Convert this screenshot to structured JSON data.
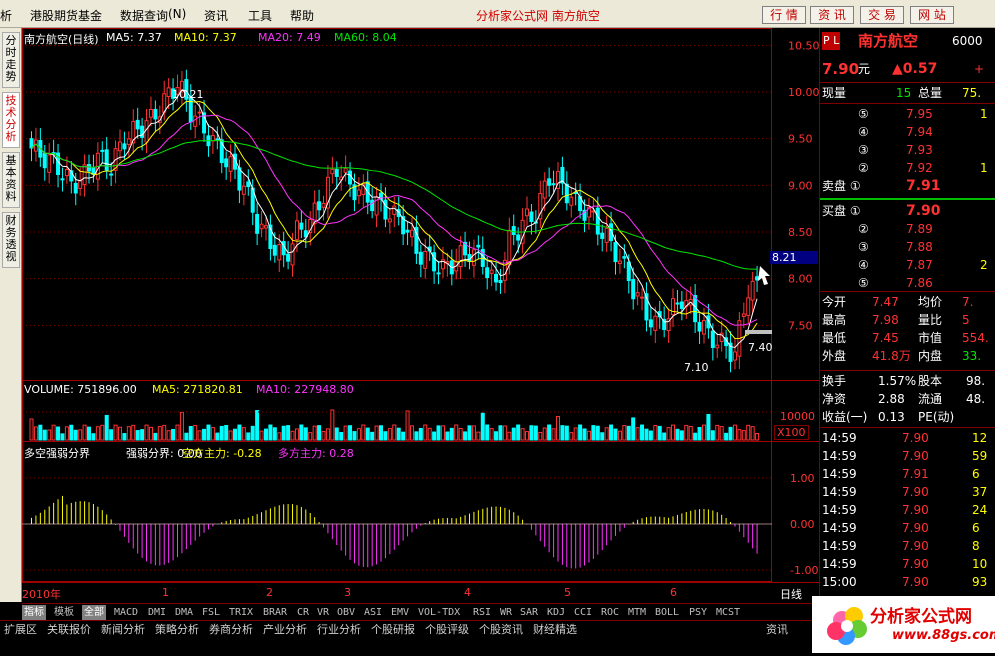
{
  "menu": {
    "items": [
      "析",
      "港股期货基金",
      "数据查询",
      "资讯",
      "工具",
      "帮助"
    ],
    "query_key": "(N)",
    "center": "分析家公式网  南方航空",
    "buttons": [
      "行 情",
      "资 讯",
      "交 易",
      "网 站"
    ]
  },
  "sidetabs": [
    "分时走势",
    "技术分析",
    "基本资料",
    "财务透视"
  ],
  "chart": {
    "main_title": "南方航空(日线)",
    "ma5": "MA5: 7.37",
    "ma10": "MA10: 7.37",
    "ma20": "MA20: 7.49",
    "ma60": "MA60: 8.04",
    "price_ticks": [
      "10.50",
      "10.00",
      "9.50",
      "9.00",
      "8.50",
      "8.00",
      "7.50"
    ],
    "current_price_tag": "8.21",
    "high_label": "10.21",
    "low_label": "7.10",
    "last_label": "7.40",
    "vol_title": "VOLUME: 751896.00",
    "vol_ma5": "MA5: 271820.81",
    "vol_ma10": "MA10: 227948.80",
    "vol_tick": "10000",
    "vol_unit": "X100",
    "ind_title": "多空强弱分界",
    "ind_a": "强弱分界: 0.00",
    "ind_b": "空方主力: -0.28",
    "ind_c": "多方主力: 0.28",
    "ind_ticks": [
      "1.00",
      "0.00",
      "-1.00"
    ],
    "x_labels": [
      "2010年",
      "1",
      "2",
      "3",
      "4",
      "5",
      "6"
    ],
    "period": "日线"
  },
  "chart_data": {
    "type": "candlestick",
    "title": "南方航空(日线)",
    "ylim": [
      7.0,
      10.6
    ],
    "high": 10.21,
    "low": 7.1,
    "last": 7.9,
    "close_approx": [
      9.4,
      9.3,
      9.2,
      9.0,
      9.1,
      9.3,
      9.2,
      9.5,
      9.6,
      9.7,
      9.9,
      10.1,
      9.8,
      9.6,
      9.4,
      9.2,
      9.0,
      8.6,
      8.4,
      8.2,
      8.5,
      8.6,
      8.9,
      9.2,
      9.0,
      8.9,
      8.8,
      8.7,
      8.6,
      8.3,
      8.2,
      8.1,
      8.2,
      8.3,
      8.2,
      7.9,
      8.4,
      8.6,
      8.7,
      9.1,
      9.0,
      8.8,
      8.7,
      8.5,
      8.3,
      8.0,
      7.7,
      7.5,
      7.6,
      7.8,
      7.6,
      7.4,
      7.3,
      7.2,
      7.9
    ]
  },
  "quote": {
    "flag": "P L",
    "name": "南方航空",
    "code": "6000",
    "price": "7.90",
    "unit": "元",
    "change": "▲0.57",
    "plus": "+",
    "xianliang_lbl": "现量",
    "xianliang": "15",
    "zongliang_lbl": "总量",
    "zongliang": "75.",
    "asks": [
      {
        "n": "⑤",
        "p": "7.95",
        "v": "1"
      },
      {
        "n": "④",
        "p": "7.94",
        "v": ""
      },
      {
        "n": "③",
        "p": "7.93",
        "v": ""
      },
      {
        "n": "②",
        "p": "7.92",
        "v": "1"
      }
    ],
    "ask1_lbl": "卖盘 ①",
    "ask1": "7.91",
    "bid1_lbl": "买盘 ①",
    "bid1": "7.90",
    "bids": [
      {
        "n": "②",
        "p": "7.89",
        "v": ""
      },
      {
        "n": "③",
        "p": "7.88",
        "v": ""
      },
      {
        "n": "④",
        "p": "7.87",
        "v": "2"
      },
      {
        "n": "⑤",
        "p": "7.86",
        "v": ""
      }
    ],
    "stats": [
      [
        "今开",
        "7.47",
        "均价",
        "7."
      ],
      [
        "最高",
        "7.98",
        "量比",
        "5"
      ],
      [
        "最低",
        "7.45",
        "市值",
        "554."
      ],
      [
        "外盘",
        "41.8万",
        "内盘",
        "33."
      ]
    ],
    "stats2": [
      [
        "换手",
        "1.57%",
        "股本",
        "98."
      ],
      [
        "净资",
        "2.88",
        "流通",
        "48."
      ],
      [
        "收益(一)",
        "0.13",
        "PE(动)",
        ""
      ]
    ],
    "ticks": [
      [
        "14:59",
        "7.90",
        "12"
      ],
      [
        "14:59",
        "7.90",
        "59"
      ],
      [
        "14:59",
        "7.91",
        "6"
      ],
      [
        "14:59",
        "7.90",
        "37"
      ],
      [
        "14:59",
        "7.90",
        "24"
      ],
      [
        "14:59",
        "7.90",
        "6"
      ],
      [
        "14:59",
        "7.90",
        "8"
      ],
      [
        "14:59",
        "7.90",
        "10"
      ],
      [
        "15:00",
        "7.90",
        "93"
      ],
      [
        "15:00",
        "7.90",
        "6"
      ]
    ]
  },
  "tabs1": [
    "指标",
    "模板",
    "全部",
    "MACD",
    "DMI",
    "DMA",
    "FSL",
    "TRIX",
    "BRAR",
    "CR",
    "VR",
    "OBV",
    "ASI",
    "EMV",
    "VOL-TDX",
    "RSI",
    "WR",
    "SAR",
    "KDJ",
    "CCI",
    "ROC",
    "MTM",
    "BOLL",
    "PSY",
    "MCST"
  ],
  "tabs2": [
    "扩展区",
    "关联报价",
    "新闻分析",
    "策略分析",
    "券商分析",
    "产业分析",
    "行业分析",
    "个股研报",
    "个股评级",
    "个股资讯",
    "财经精选"
  ],
  "status": "资讯",
  "logo": {
    "text": "分析家公式网",
    "url": "www.88gs.com"
  }
}
